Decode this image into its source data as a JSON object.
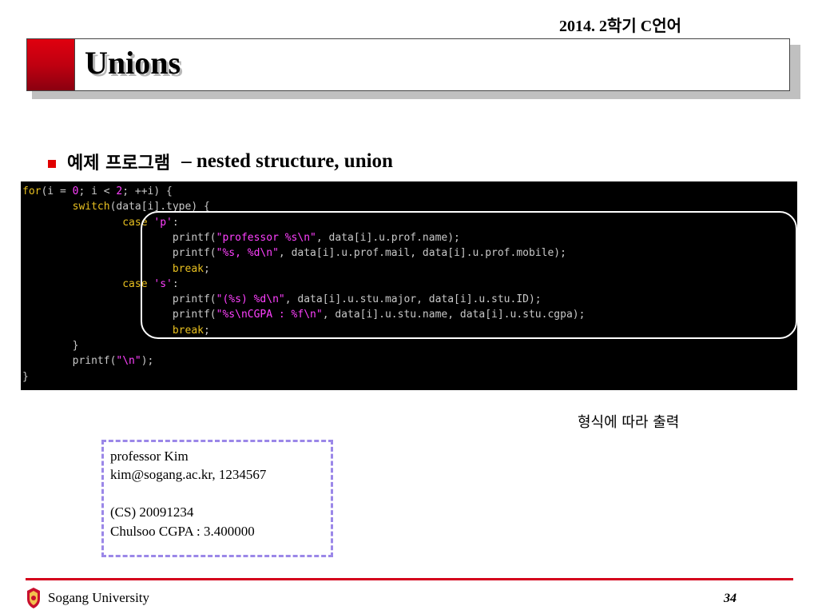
{
  "header": {
    "course": "2014. 2학기 C언어"
  },
  "title": {
    "text": "Unions"
  },
  "bullet": {
    "korean": "예제 프로그램",
    "english": "– nested structure, union"
  },
  "code": {
    "lines": [
      [
        {
          "t": "for",
          "c": "kw"
        },
        {
          "t": "(i = ",
          "c": "plain"
        },
        {
          "t": "0",
          "c": "num"
        },
        {
          "t": "; i < ",
          "c": "plain"
        },
        {
          "t": "2",
          "c": "num"
        },
        {
          "t": "; ++i) {",
          "c": "plain"
        }
      ],
      [
        {
          "t": "        ",
          "c": "plain"
        },
        {
          "t": "switch",
          "c": "kw"
        },
        {
          "t": "(data[i].type) {",
          "c": "plain"
        }
      ],
      [
        {
          "t": "                ",
          "c": "plain"
        },
        {
          "t": "case",
          "c": "kw"
        },
        {
          "t": " ",
          "c": "plain"
        },
        {
          "t": "'p'",
          "c": "str"
        },
        {
          "t": ":",
          "c": "plain"
        }
      ],
      [
        {
          "t": "                        printf(",
          "c": "plain"
        },
        {
          "t": "\"professor %s\\n\"",
          "c": "str"
        },
        {
          "t": ", data[i].u.prof.name);",
          "c": "plain"
        }
      ],
      [
        {
          "t": "                        printf(",
          "c": "plain"
        },
        {
          "t": "\"%s, %d\\n\"",
          "c": "str"
        },
        {
          "t": ", data[i].u.prof.mail, data[i].u.prof.mobile);",
          "c": "plain"
        }
      ],
      [
        {
          "t": "                        ",
          "c": "plain"
        },
        {
          "t": "break",
          "c": "kw"
        },
        {
          "t": ";",
          "c": "plain"
        }
      ],
      [
        {
          "t": "                ",
          "c": "plain"
        },
        {
          "t": "case",
          "c": "kw"
        },
        {
          "t": " ",
          "c": "plain"
        },
        {
          "t": "'s'",
          "c": "str"
        },
        {
          "t": ":",
          "c": "plain"
        }
      ],
      [
        {
          "t": "                        printf(",
          "c": "plain"
        },
        {
          "t": "\"(%s) %d\\n\"",
          "c": "str"
        },
        {
          "t": ", data[i].u.stu.major, data[i].u.stu.ID);",
          "c": "plain"
        }
      ],
      [
        {
          "t": "                        printf(",
          "c": "plain"
        },
        {
          "t": "\"%s\\nCGPA : %f\\n\"",
          "c": "str"
        },
        {
          "t": ", data[i].u.stu.name, data[i].u.stu.cgpa);",
          "c": "plain"
        }
      ],
      [
        {
          "t": "                        ",
          "c": "plain"
        },
        {
          "t": "break",
          "c": "kw"
        },
        {
          "t": ";",
          "c": "plain"
        }
      ],
      [
        {
          "t": "        }",
          "c": "plain"
        }
      ],
      [
        {
          "t": "        printf(",
          "c": "plain"
        },
        {
          "t": "\"\\n\"",
          "c": "str"
        },
        {
          "t": ");",
          "c": "plain"
        }
      ],
      [
        {
          "t": "}",
          "c": "plain"
        }
      ]
    ]
  },
  "annotation": {
    "caption": "형식에 따라 출력"
  },
  "output": {
    "lines": [
      "professor Kim",
      "kim@sogang.ac.kr, 1234567",
      "(CS) 20091234",
      "Chulsoo CGPA : 3.400000"
    ]
  },
  "footer": {
    "university": "Sogang University",
    "page_number": "34",
    "logo_icon": "sogang-crest-icon"
  },
  "colors": {
    "accent_red": "#d4001c",
    "code_bg": "#000000",
    "keyword": "#e8c020",
    "string": "#ff40ff",
    "output_border": "#9b87e8"
  }
}
